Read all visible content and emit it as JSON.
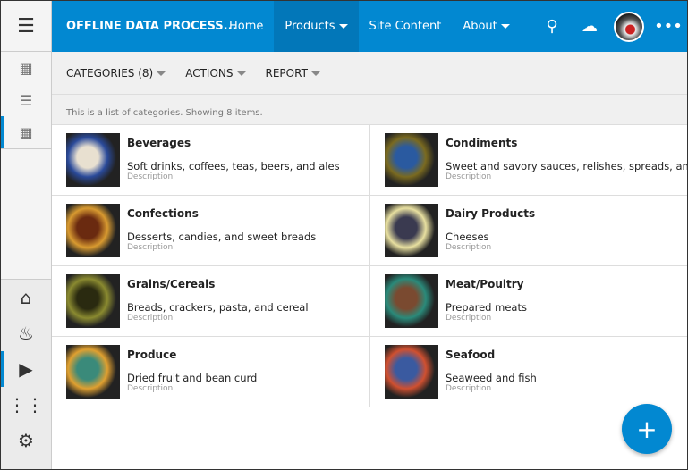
{
  "header": {
    "title": "OFFLINE DATA PROCESS...",
    "nav": [
      {
        "label": "Home"
      },
      {
        "label": "Products",
        "dropdown": true,
        "active": true
      },
      {
        "label": "Site Content"
      },
      {
        "label": "About",
        "dropdown": true
      }
    ]
  },
  "toolbar": {
    "items": [
      "CATEGORIES (8)",
      "ACTIONS",
      "REPORT"
    ]
  },
  "info": "This is a list of categories. Showing 8 items.",
  "desc_label": "Description",
  "categories": [
    {
      "name": "Beverages",
      "description": "Soft drinks, coffees, teas, beers, and ales",
      "colors": [
        "#2a4a9a",
        "#e8e0d0"
      ]
    },
    {
      "name": "Condiments",
      "description": "Sweet and savory sauces, relishes, spreads, and seasonings",
      "colors": [
        "#7a6a20",
        "#2a5aa0"
      ]
    },
    {
      "name": "Confections",
      "description": "Desserts, candies, and sweet breads",
      "colors": [
        "#d89a30",
        "#6a2a10"
      ]
    },
    {
      "name": "Dairy Products",
      "description": "Cheeses",
      "colors": [
        "#e8e0a0",
        "#3a3a50"
      ]
    },
    {
      "name": "Grains/Cereals",
      "description": "Breads, crackers, pasta, and cereal",
      "colors": [
        "#8a8a30",
        "#2a2a10"
      ]
    },
    {
      "name": "Meat/Poultry",
      "description": "Prepared meats",
      "colors": [
        "#2a8a7a",
        "#7a4a30"
      ]
    },
    {
      "name": "Produce",
      "description": "Dried fruit and bean curd",
      "colors": [
        "#e0a030",
        "#3a8a7a"
      ]
    },
    {
      "name": "Seafood",
      "description": "Seaweed and fish",
      "colors": [
        "#d05030",
        "#3a5aa0"
      ]
    }
  ],
  "accent": "#0288d1"
}
